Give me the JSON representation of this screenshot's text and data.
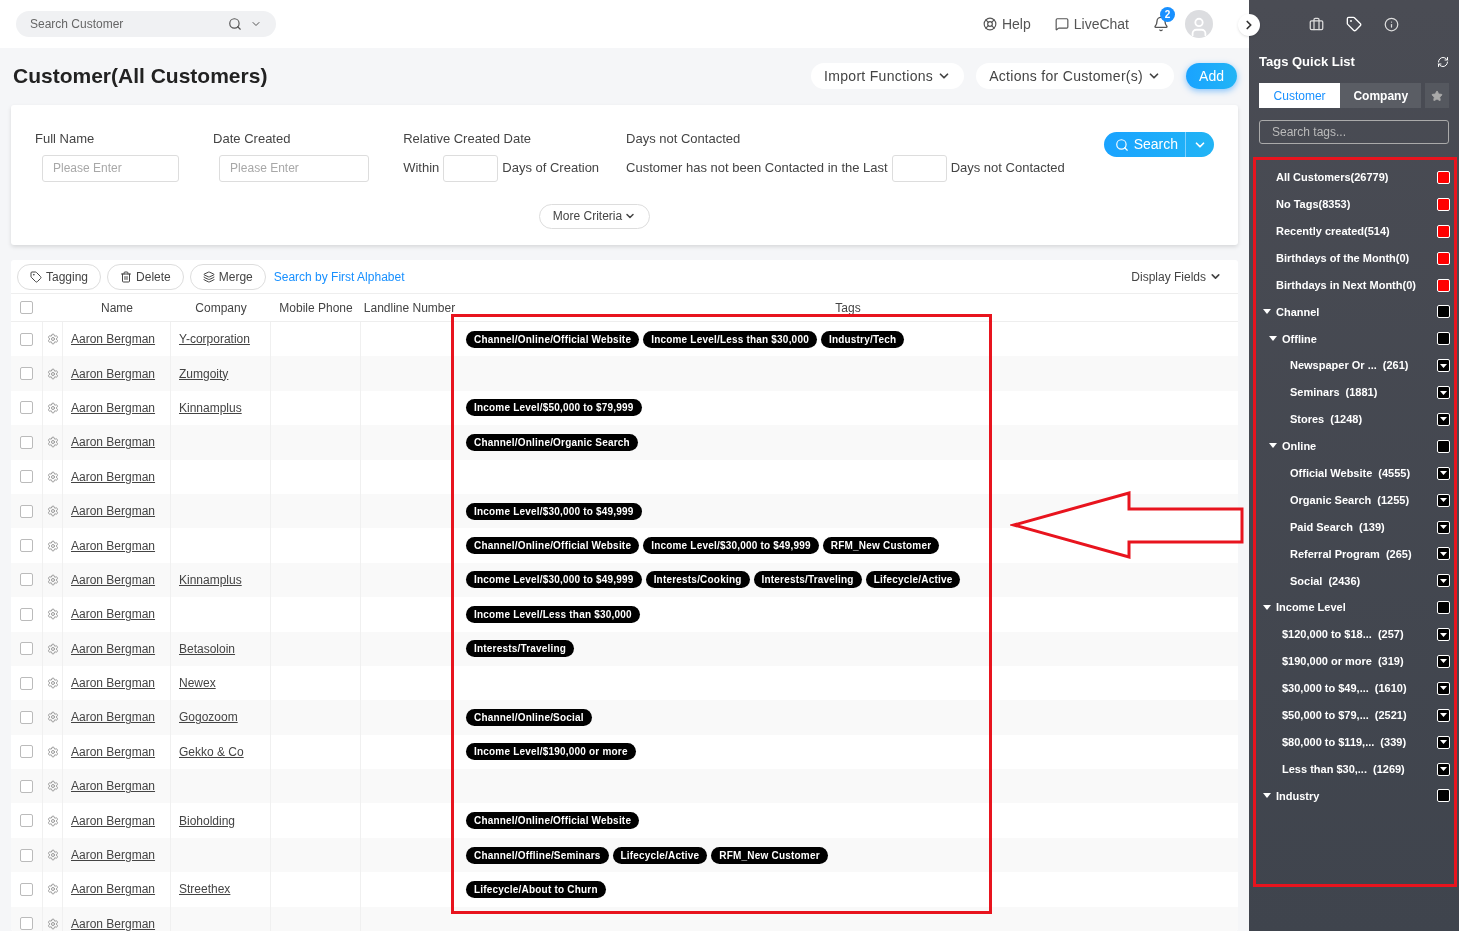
{
  "topbar": {
    "search": {
      "placeholder": "Search Customer"
    },
    "links": [
      {
        "kind": "help",
        "label": "Help"
      },
      {
        "kind": "chat",
        "label": "LiveChat"
      }
    ],
    "notifications": "2"
  },
  "page": {
    "title": "Customer(All Customers)",
    "actions": [
      {
        "label": "Import Functions",
        "kind": "menu"
      },
      {
        "label": "Actions for Customer(s)",
        "kind": "menu"
      },
      {
        "label": "Add",
        "kind": "primary"
      }
    ]
  },
  "filters": {
    "full_name": {
      "label": "Full Name",
      "placeholder": "Please Enter"
    },
    "date_created": {
      "label": "Date Created",
      "placeholder": "Please Enter"
    },
    "relative_created": {
      "label": "Relative Created Date",
      "before": "Within",
      "after": "Days of Creation"
    },
    "days_not_contacted": {
      "label": "Days not Contacted",
      "before": "Customer has not been Contacted in the Last",
      "after": "Days not Contacted"
    },
    "search_button": "Search",
    "more": "More Criteria"
  },
  "toolbar": {
    "buttons": [
      {
        "kind": "tag",
        "label": "Tagging"
      },
      {
        "kind": "trash",
        "label": "Delete"
      },
      {
        "kind": "layers",
        "label": "Merge"
      }
    ],
    "alphabet_link": "Search by First Alphabet",
    "display_fields": "Display Fields"
  },
  "table": {
    "header_checked": false,
    "columns": [
      "Name",
      "Company",
      "Mobile Phone",
      "Landline Number",
      "Tags"
    ],
    "rows": [
      {
        "checked": false,
        "name": "Aaron Bergman",
        "company": "Y-corporation",
        "tags": [
          "Channel/Online/Official Website",
          "Income Level/Less than $30,000",
          "Industry/Tech"
        ]
      },
      {
        "checked": false,
        "name": "Aaron Bergman",
        "company": "Zumgoity",
        "tags": []
      },
      {
        "checked": false,
        "name": "Aaron Bergman",
        "company": "Kinnamplus",
        "tags": [
          "Income Level/$50,000 to $79,999"
        ]
      },
      {
        "checked": false,
        "name": "Aaron Bergman",
        "company": "",
        "tags": [
          "Channel/Online/Organic Search"
        ]
      },
      {
        "checked": false,
        "name": "Aaron Bergman",
        "company": "",
        "tags": []
      },
      {
        "checked": false,
        "name": "Aaron Bergman",
        "company": "",
        "tags": [
          "Income Level/$30,000 to $49,999"
        ]
      },
      {
        "checked": false,
        "name": "Aaron Bergman",
        "company": "",
        "tags": [
          "Channel/Online/Official Website",
          "Income Level/$30,000 to $49,999",
          "RFM_New Customer"
        ]
      },
      {
        "checked": false,
        "name": "Aaron Bergman",
        "company": "Kinnamplus",
        "tags": [
          "Income Level/$30,000 to $49,999",
          "Interests/Cooking",
          "Interests/Traveling",
          "Lifecycle/Active"
        ]
      },
      {
        "checked": false,
        "name": "Aaron Bergman",
        "company": "",
        "tags": [
          "Income Level/Less than $30,000"
        ]
      },
      {
        "checked": false,
        "name": "Aaron Bergman",
        "company": "Betasoloin",
        "tags": [
          "Interests/Traveling"
        ]
      },
      {
        "checked": false,
        "name": "Aaron Bergman",
        "company": "Newex",
        "tags": []
      },
      {
        "checked": false,
        "name": "Aaron Bergman",
        "company": "Gogozoom",
        "tags": [
          "Channel/Online/Social"
        ]
      },
      {
        "checked": false,
        "name": "Aaron Bergman",
        "company": "Gekko & Co",
        "tags": [
          "Income Level/$190,000 or more"
        ]
      },
      {
        "checked": false,
        "name": "Aaron Bergman",
        "company": "",
        "tags": []
      },
      {
        "checked": false,
        "name": "Aaron Bergman",
        "company": "Bioholding",
        "tags": [
          "Channel/Online/Official Website"
        ]
      },
      {
        "checked": false,
        "name": "Aaron Bergman",
        "company": "",
        "tags": [
          "Channel/Offline/Seminars",
          "Lifecycle/Active",
          "RFM_New Customer"
        ]
      },
      {
        "checked": false,
        "name": "Aaron Bergman",
        "company": "Streethex",
        "tags": [
          "Lifecycle/About to Churn"
        ]
      },
      {
        "checked": false,
        "name": "Aaron Bergman",
        "company": "",
        "tags": []
      }
    ]
  },
  "sidebar": {
    "title": "Tags Quick List",
    "tabs": [
      {
        "label": "Customer",
        "selected": true
      },
      {
        "label": "Company",
        "selected": false
      }
    ],
    "search": {
      "placeholder": "Search tags..."
    },
    "items": [
      {
        "kind": "system",
        "label": "All Customers(26779)",
        "checked": false
      },
      {
        "kind": "system",
        "label": "No Tags(8353)",
        "checked": false
      },
      {
        "kind": "system",
        "label": "Recently created(514)",
        "checked": false
      },
      {
        "kind": "system",
        "label": "Birthdays of the Month(0)",
        "checked": false
      },
      {
        "kind": "system",
        "label": "Birthdays in Next Month(0)",
        "checked": false
      },
      {
        "kind": "group",
        "label": "Channel",
        "expanded": true,
        "checked": false,
        "children": [
          {
            "kind": "group",
            "label": "Offline",
            "expanded": true,
            "checked": false,
            "children": [
              {
                "kind": "tag",
                "label": "Newspaper Or ...",
                "count": "(261)"
              },
              {
                "kind": "tag",
                "label": "Seminars",
                "count": "(1881)"
              },
              {
                "kind": "tag",
                "label": "Stores",
                "count": "(1248)"
              }
            ]
          },
          {
            "kind": "group",
            "label": "Online",
            "expanded": true,
            "checked": false,
            "children": [
              {
                "kind": "tag",
                "label": "Official Website",
                "count": "(4555)"
              },
              {
                "kind": "tag",
                "label": "Organic Search",
                "count": "(1255)"
              },
              {
                "kind": "tag",
                "label": "Paid Search",
                "count": "(139)"
              },
              {
                "kind": "tag",
                "label": "Referral Program",
                "count": "(265)"
              },
              {
                "kind": "tag",
                "label": "Social",
                "count": "(2436)"
              }
            ]
          }
        ]
      },
      {
        "kind": "group",
        "label": "Income Level",
        "expanded": true,
        "checked": false,
        "children": [
          {
            "kind": "tag",
            "label": "$120,000 to $18...",
            "count": "(257)"
          },
          {
            "kind": "tag",
            "label": "$190,000 or more",
            "count": "(319)"
          },
          {
            "kind": "tag",
            "label": "$30,000 to $49,...",
            "count": "(1610)"
          },
          {
            "kind": "tag",
            "label": "$50,000 to $79,...",
            "count": "(2521)"
          },
          {
            "kind": "tag",
            "label": "$80,000 to $119,...",
            "count": "(339)"
          },
          {
            "kind": "tag",
            "label": "Less than $30,...",
            "count": "(1269)"
          }
        ]
      },
      {
        "kind": "group",
        "label": "Industry",
        "expanded": true,
        "checked": false
      }
    ]
  }
}
